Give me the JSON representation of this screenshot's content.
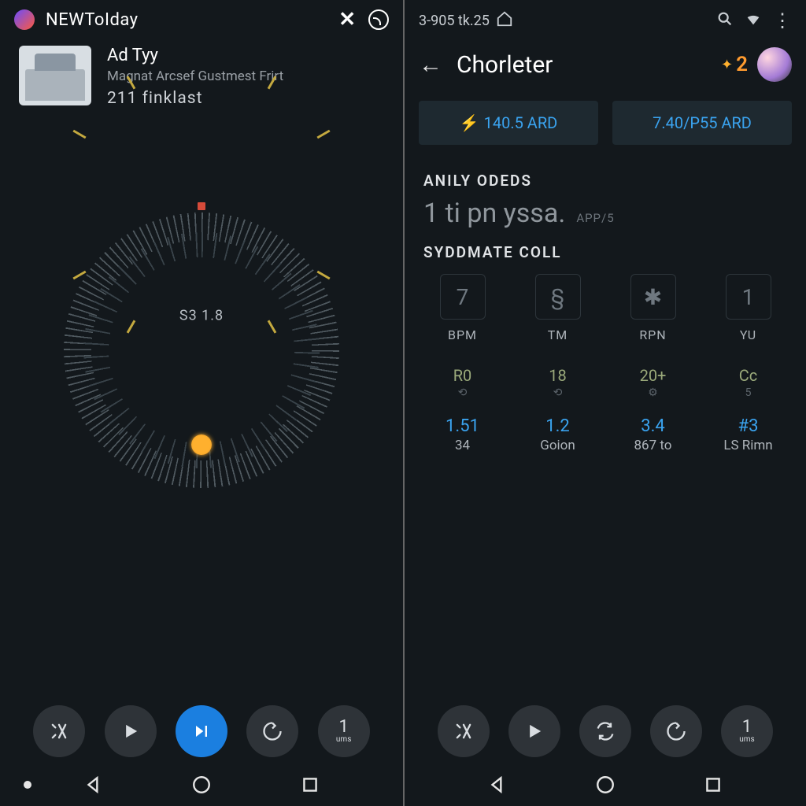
{
  "left": {
    "status": {
      "title": "NEWToIday"
    },
    "card": {
      "title": "Ad Tyy",
      "subtitle": "Magnat Arcsef Gustmest Frirt",
      "meta": "211 finklast"
    },
    "dial": {
      "center": "S3 1.8"
    },
    "controls": {
      "c5_top": "1",
      "c5_bot": "ums"
    }
  },
  "right": {
    "status": {
      "time": "3-905 tk.25"
    },
    "header": {
      "title": "Chorleter",
      "badge": "2"
    },
    "pills": [
      {
        "text": "140.5 ARD"
      },
      {
        "text": "7.40/P55 ARD"
      }
    ],
    "sec1": {
      "heading": "ANILY ODEDS",
      "big": "1 ti pn yssa.",
      "tag": "APP/5"
    },
    "sec2": {
      "heading": "SYDDMATE COLL"
    },
    "stats": [
      {
        "box": "7",
        "lbl": "BPM"
      },
      {
        "box": "§",
        "lbl": "TM"
      },
      {
        "box": "✱",
        "lbl": "RPN"
      },
      {
        "box": "1",
        "lbl": "YU"
      }
    ],
    "row2": [
      {
        "a": "R0",
        "b": "⟲"
      },
      {
        "a": "18",
        "b": "⟲"
      },
      {
        "a": "20+",
        "b": "⚙"
      },
      {
        "a": "Cc",
        "b": "5"
      }
    ],
    "row3": [
      {
        "a": "1.51",
        "c": "34"
      },
      {
        "a": "1.2",
        "c": "Goion"
      },
      {
        "a": "3.4",
        "c": "867 to"
      },
      {
        "a": "#3",
        "c": "LS Rimn"
      }
    ],
    "controls": {
      "c5_top": "1",
      "c5_bot": "ums"
    }
  }
}
